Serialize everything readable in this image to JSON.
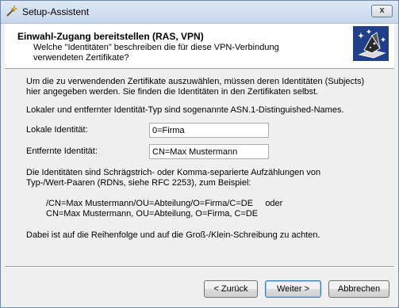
{
  "window": {
    "title": "Setup-Assistent",
    "close_glyph": "x"
  },
  "header": {
    "title": "Einwahl-Zugang bereitstellen (RAS, VPN)",
    "subtitle_line1": "Welche \"Identitäten\" beschreiben die für diese VPN-Verbindung",
    "subtitle_line2": "verwendeten Zertifikate?"
  },
  "content": {
    "intro_line1": "Um die zu verwendenden Zertifikate auszuwählen, müssen deren Identitäten (Subjects)",
    "intro_line2": "hier angegeben werden. Sie finden die Identitäten in den Zertifikaten selbst.",
    "asn_note": "Lokaler und entfernter Identität-Typ sind sogenannte ASN.1-Distinguished-Names.",
    "local_label": "Lokale Identität:",
    "local_value": "0=Firma",
    "remote_label": "Entfernte Identität:",
    "remote_value": "CN=Max Mustermann",
    "explain_line1": "Die Identitäten sind Schrägstrich- oder Komma-separierte Aufzählungen von",
    "explain_line2": "Typ-/Wert-Paaren (RDNs, siehe RFC 2253), zum Beispiel:",
    "example_line1": "/CN=Max Mustermann/OU=Abteilung/O=Firma/C=DE     oder",
    "example_line2": "CN=Max Mustermann, OU=Abteilung, O=Firma, C=DE",
    "note": "Dabei ist auf die Reihenfolge und auf die Groß-/Klein-Schreibung zu achten."
  },
  "buttons": {
    "back": "< Zurück",
    "next": "Weiter >",
    "cancel": "Abbrechen"
  },
  "colors": {
    "accent": "#3c7fb1",
    "icon_bg": "#1f3f8a"
  }
}
